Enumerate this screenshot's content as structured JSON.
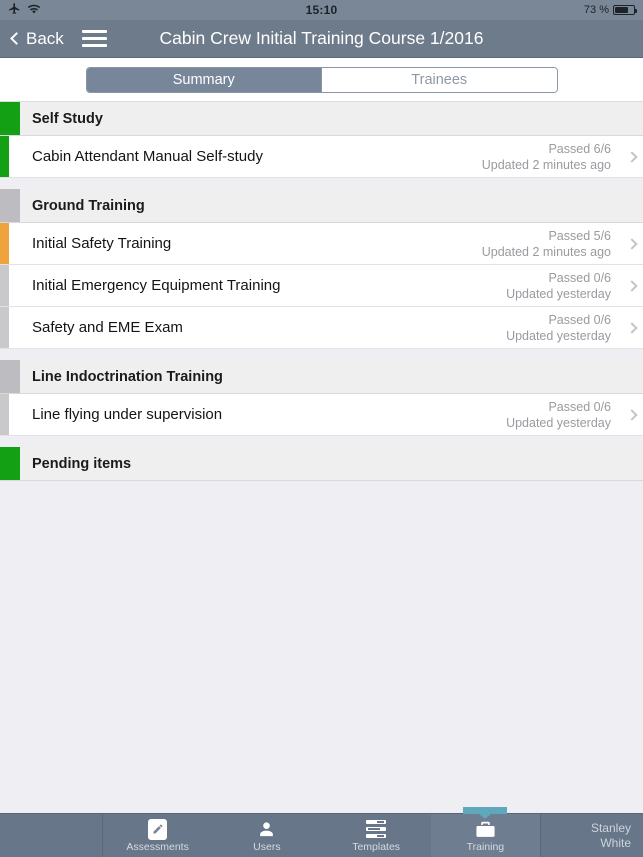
{
  "status_bar": {
    "airplane_icon": "airplane-icon",
    "wifi_icon": "wifi-icon",
    "time": "15:10",
    "battery_percent": "73 %",
    "battery_icon": "battery-icon"
  },
  "nav": {
    "back_label": "Back",
    "menu_icon": "hamburger-menu-icon",
    "title": "Cabin Crew Initial Training Course 1/2016"
  },
  "segmented": {
    "options": [
      {
        "label": "Summary",
        "selected": true
      },
      {
        "label": "Trainees",
        "selected": false
      }
    ]
  },
  "colors": {
    "accent_green": "#14a014",
    "accent_orange": "#f0a33c",
    "accent_gray": "#c9c9cc",
    "accent_gray_dark": "#bdbdc1",
    "navbar": "#6d7b8b",
    "tabbar": "#68768a",
    "tab_indicator": "#5ea7bd",
    "segment_selected": "#78869a"
  },
  "sections": [
    {
      "title": "Self Study",
      "accent": "#14a014",
      "rows": [
        {
          "label": "Cabin Attendant Manual Self-study",
          "status": "Passed 6/6",
          "updated": "Updated 2 minutes ago",
          "accent": "#14a014"
        }
      ]
    },
    {
      "title": "Ground Training",
      "accent": "#bdbdc1",
      "rows": [
        {
          "label": "Initial Safety Training",
          "status": "Passed 5/6",
          "updated": "Updated 2 minutes ago",
          "accent": "#f0a33c"
        },
        {
          "label": "Initial Emergency Equipment Training",
          "status": "Passed 0/6",
          "updated": "Updated yesterday",
          "accent": "#c9c9cc"
        },
        {
          "label": "Safety and EME Exam",
          "status": "Passed 0/6",
          "updated": "Updated yesterday",
          "accent": "#c9c9cc"
        }
      ]
    },
    {
      "title": "Line Indoctrination Training",
      "accent": "#bdbdc1",
      "rows": [
        {
          "label": "Line flying under supervision",
          "status": "Passed 0/6",
          "updated": "Updated yesterday",
          "accent": "#c9c9cc"
        }
      ]
    },
    {
      "title": "Pending items",
      "accent": "#14a014",
      "rows": []
    }
  ],
  "tabbar": {
    "tabs": [
      {
        "label": "Assessments",
        "icon": "pencil-note-icon",
        "selected": false
      },
      {
        "label": "Users",
        "icon": "person-icon",
        "selected": false
      },
      {
        "label": "Templates",
        "icon": "templates-list-icon",
        "selected": false
      },
      {
        "label": "Training",
        "icon": "briefcase-icon",
        "selected": true
      }
    ],
    "user_first_name": "Stanley",
    "user_last_name": "White"
  }
}
